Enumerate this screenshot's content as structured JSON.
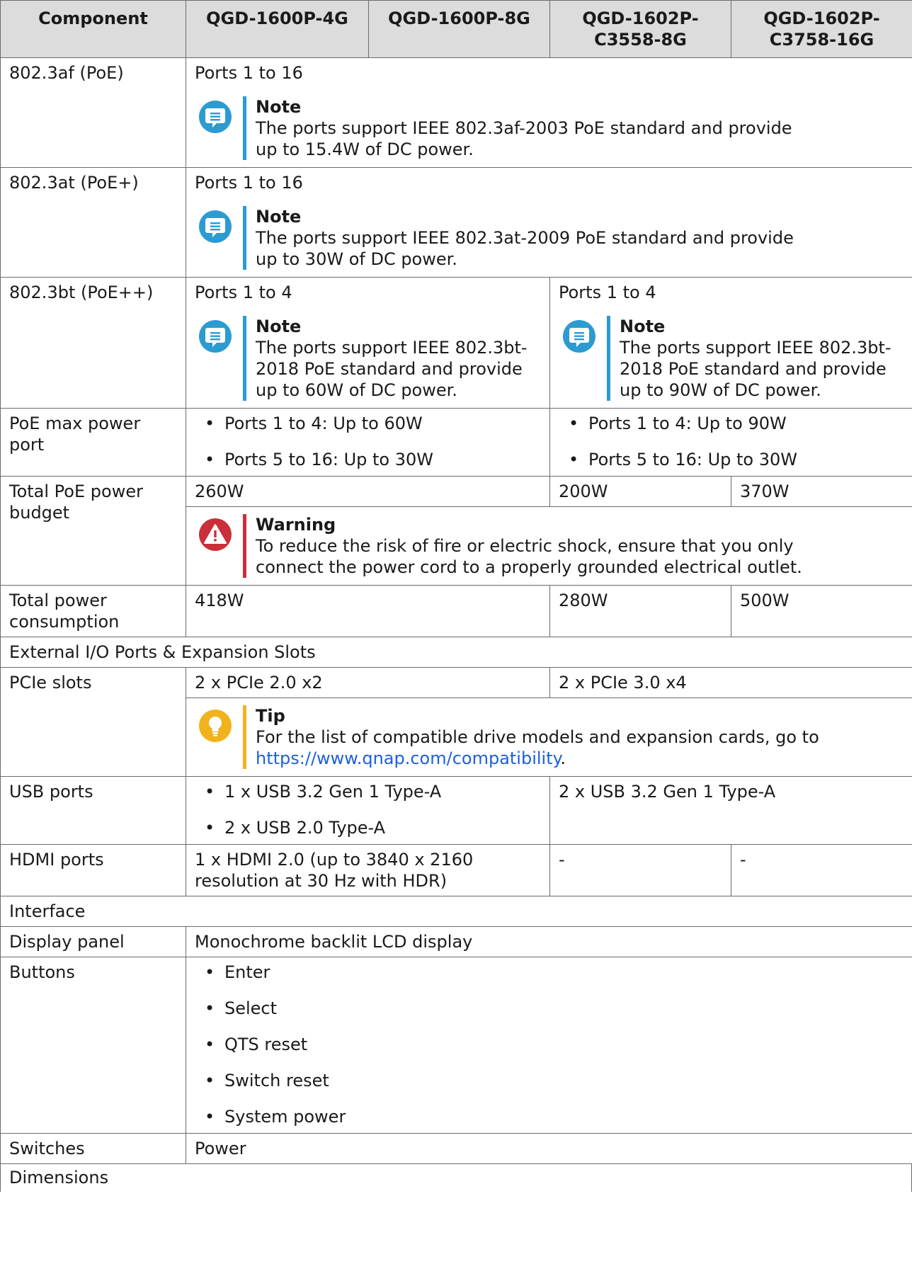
{
  "header": [
    "Component",
    "QGD-1600P-4G",
    "QGD-1600P-8G",
    "QGD-1602P-\nC3558-8G",
    "QGD-1602P-\nC3758-16G"
  ],
  "note_title": "Note",
  "warning_title": "Warning",
  "tip_title": "Tip",
  "rows": {
    "af": {
      "label": "802.3af (PoE)",
      "value": "Ports 1 to 16",
      "note": "The ports support IEEE 802.3af-2003 PoE standard and provide up to 15.4W of DC power."
    },
    "at": {
      "label": "802.3at (PoE+)",
      "value": "Ports 1 to 16",
      "note": "The ports support IEEE 802.3at-2009 PoE standard and provide up to 30W of DC power."
    },
    "bt": {
      "label": "802.3bt (PoE++)",
      "value_a": "Ports 1 to 4",
      "value_b": "Ports 1 to 4",
      "note_a": "The ports support IEEE 802.3bt-2018 PoE standard and provide up to 60W of DC power.",
      "note_b": "The ports support IEEE 802.3bt-2018 PoE standard and provide up to 90W of DC power."
    },
    "maxport": {
      "label": "PoE max power port",
      "items_a": [
        "Ports 1 to 4: Up to 60W",
        "Ports 5 to 16: Up to 30W"
      ],
      "items_b": [
        "Ports 1 to 4: Up to 90W",
        "Ports 5 to 16: Up to 30W"
      ]
    },
    "budget": {
      "label": "Total PoE power budget",
      "v1": "260W",
      "v2": "200W",
      "v3": "370W",
      "warning": "To reduce the risk of fire or electric shock, ensure that you only connect the power cord to a properly grounded electrical outlet."
    },
    "consumption": {
      "label": "Total power consumption",
      "v1": "418W",
      "v2": "280W",
      "v3": "500W"
    },
    "io_section": "External I/O Ports & Expansion Slots",
    "pcie": {
      "label": "PCIe slots",
      "v1": "2 x PCIe 2.0 x2",
      "v2": "2 x PCIe 3.0 x4",
      "tip_text": "For the list of compatible drive models and expansion cards, go to ",
      "tip_link": "https://www.qnap.com/compatibility",
      "tip_end": "."
    },
    "usb": {
      "label": "USB ports",
      "items_a": [
        "1 x USB 3.2 Gen 1 Type-A",
        "2 x USB 2.0 Type-A"
      ],
      "v2": "2 x USB 3.2 Gen 1 Type-A"
    },
    "hdmi": {
      "label": "HDMI ports",
      "v1": "1 x HDMI 2.0 (up to 3840 x 2160 resolution at 30 Hz with HDR)",
      "v2": "-",
      "v3": "-"
    },
    "interface_section": "Interface",
    "display": {
      "label": "Display panel",
      "value": "Monochrome backlit LCD display"
    },
    "buttons": {
      "label": "Buttons",
      "items": [
        "Enter",
        "Select",
        "QTS reset",
        "Switch reset",
        "System power"
      ]
    },
    "switches": {
      "label": "Switches",
      "value": "Power"
    },
    "dimensions_section": "Dimensions"
  },
  "colors": {
    "info": "#2b9bd1",
    "warning": "#c9303a",
    "tip": "#f0b31c",
    "link": "#1d5fe0",
    "header_bg": "#dcdcdc"
  },
  "icons": {
    "note": "speech-bubble-icon",
    "warning": "warning-triangle-icon",
    "tip": "lightbulb-icon"
  }
}
